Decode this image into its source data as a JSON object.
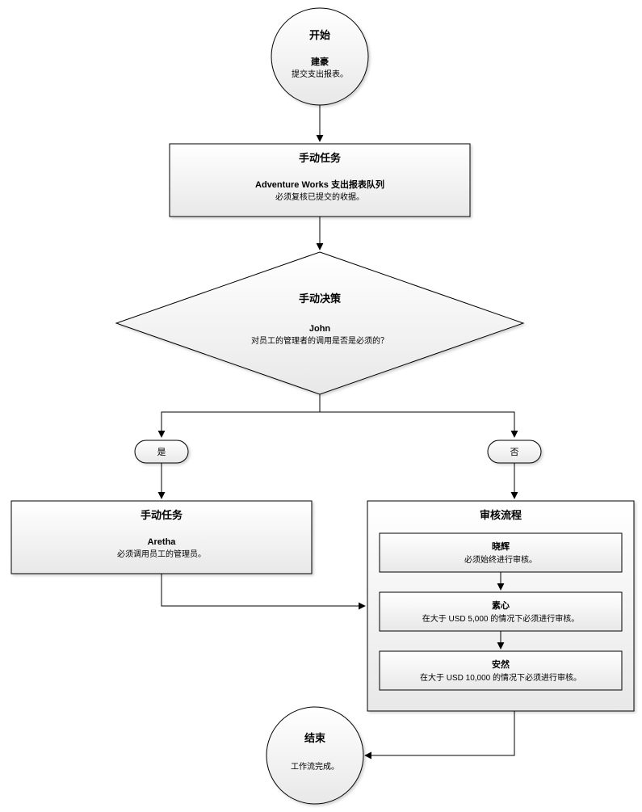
{
  "start": {
    "title": "开始",
    "actor": "建豪",
    "desc": "提交支出报表。"
  },
  "task1": {
    "title": "手动任务",
    "actor": "Adventure Works 支出报表队列",
    "desc": "必须复核已提交的收据。"
  },
  "decision": {
    "title": "手动决策",
    "actor": "John",
    "desc": "对员工的管理者的调用是否是必须的？"
  },
  "yes": "是",
  "no": "否",
  "task2": {
    "title": "手动任务",
    "actor": "Aretha",
    "desc": "必须调用员工的管理员。"
  },
  "approval": {
    "title": "审核流程",
    "steps": [
      {
        "actor": "晓辉",
        "desc": "必须始终进行审核。"
      },
      {
        "actor": "素心",
        "desc": "在大于 USD 5,000 的情况下必须进行审核。"
      },
      {
        "actor": "安然",
        "desc": "在大于 USD 10,000 的情况下必须进行审核。"
      }
    ]
  },
  "end": {
    "title": "结束",
    "desc": "工作流完成。"
  }
}
